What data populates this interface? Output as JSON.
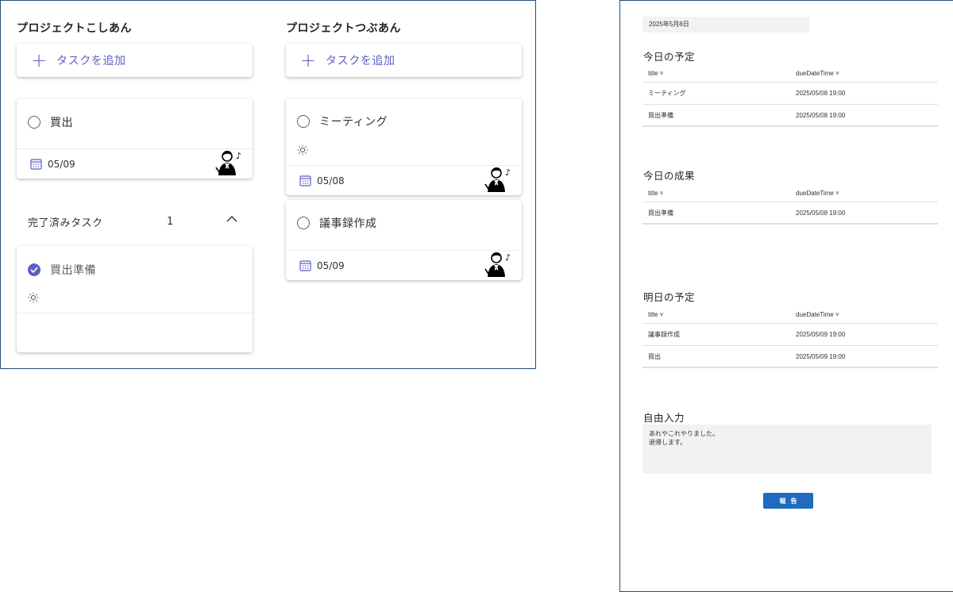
{
  "planner": {
    "buckets": [
      {
        "title": "プロジェクトこしあん",
        "add_label": "タスクを追加",
        "tasks": [
          {
            "title": "買出",
            "due": "05/09",
            "done": false
          }
        ],
        "completed": {
          "label": "完了済みタスク",
          "count": "1",
          "tasks": [
            {
              "title": "買出準備",
              "done": true
            }
          ]
        }
      },
      {
        "title": "プロジェクトつぶあん",
        "add_label": "タスクを追加",
        "tasks": [
          {
            "title": "ミーティング",
            "due": "05/08",
            "done": false
          },
          {
            "title": "議事録作成",
            "due": "05/09",
            "done": false
          }
        ]
      }
    ]
  },
  "report": {
    "date": "2025年5月8日",
    "columns": {
      "title": "title",
      "due": "dueDateTime"
    },
    "sections": [
      {
        "heading": "今日の予定",
        "rows": [
          {
            "title": "ミーティング",
            "due": "2025/05/08 19:00"
          },
          {
            "title": "買出準備",
            "due": "2025/05/08 19:00"
          }
        ]
      },
      {
        "heading": "今日の成果",
        "rows": [
          {
            "title": "買出準備",
            "due": "2025/05/08 19:00"
          }
        ]
      },
      {
        "heading": "明日の予定",
        "rows": [
          {
            "title": "議事録作成",
            "due": "2025/05/09 19:00"
          },
          {
            "title": "買出",
            "due": "2025/05/09 19:00"
          }
        ]
      }
    ],
    "free_input": {
      "heading": "自由入力",
      "line1": "あれやこれやりました。",
      "line2": "退帰します。"
    },
    "submit_label": "報告"
  },
  "colors": {
    "accent": "#5b5fc7",
    "frame": "#1f4e79",
    "button": "#1f6bbf"
  }
}
